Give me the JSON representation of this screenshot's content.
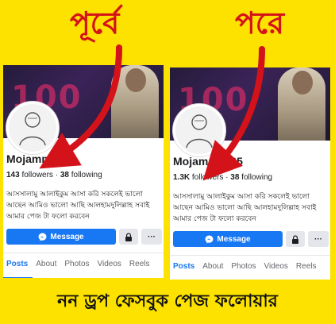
{
  "headings": {
    "before": "পূর্বে",
    "after": "পরে"
  },
  "panels": [
    {
      "name": "Mojammel 95",
      "followers": "143",
      "followers_label": "followers",
      "following": "38",
      "following_label": "following",
      "bio": "আসসালামু আলাইকুম আসা করি সকলেই ভালো আছেন আমিও ভালো আছি আলহামদুলিল্লাহ সবাই আমার পেজ টা ফলো করবেন",
      "message_label": "Message",
      "more_label": "···",
      "tabs": [
        "Posts",
        "About",
        "Photos",
        "Videos",
        "Reels"
      ],
      "cover_text": "100"
    },
    {
      "name": "Mojammel 95",
      "followers": "1.3K",
      "followers_label": "followers",
      "following": "38",
      "following_label": "following",
      "bio": "আসসালামু আলাইকুম আসা করি সকলেই ভালো আছেন আমিও ভালো আছি আলহামদুলিল্লাহ সবাই আমার পেজ টা ফলো করবেন",
      "message_label": "Message",
      "more_label": "···",
      "tabs": [
        "Posts",
        "About",
        "Photos",
        "Videos",
        "Reels"
      ],
      "cover_text": "100"
    }
  ],
  "banner": "নন ড্রপ ফেসবুক পেজ ফলোয়ার",
  "colors": {
    "background": "#fde200",
    "heading": "#d4121a",
    "accent": "#1877f2"
  }
}
